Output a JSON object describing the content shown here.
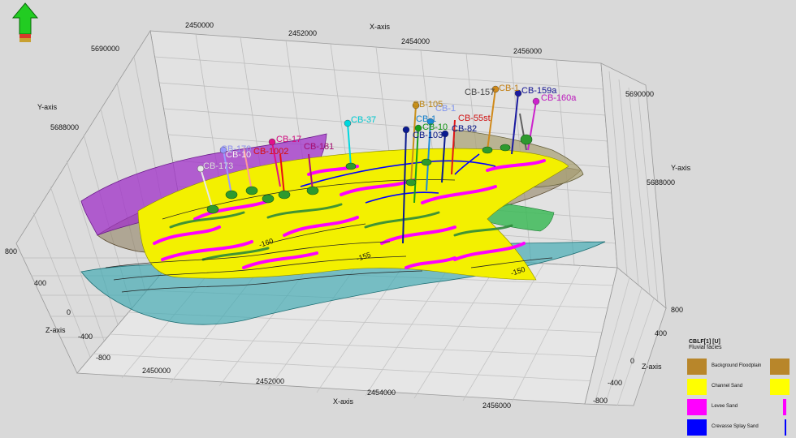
{
  "axes": {
    "x_title": "X-axis",
    "y_title": "Y-axis",
    "z_title": "Z-axis",
    "x_ticks_top": [
      "2450000",
      "2452000",
      "2454000",
      "2456000"
    ],
    "x_ticks_bottom": [
      "2450000",
      "2452000",
      "2454000",
      "2456000"
    ],
    "y_ticks_left": [
      "5690000",
      "5688000"
    ],
    "y_ticks_right": [
      "5690000",
      "5688000"
    ],
    "z_ticks_left": [
      "800",
      "400",
      "0",
      "-400",
      "-800"
    ],
    "z_ticks_right": [
      "800",
      "400",
      "0",
      "-400",
      "-800"
    ]
  },
  "wells": [
    {
      "name": "CB-157",
      "color": "#505050"
    },
    {
      "name": "CB-1",
      "color": "#d08a1a"
    },
    {
      "name": "CB-159a",
      "color": "#1a1aa0"
    },
    {
      "name": "CB-160a",
      "color": "#cc22cc"
    },
    {
      "name": "CB-105",
      "color": "#c8901a"
    },
    {
      "name": "CB-1",
      "color": "#8aa0ff"
    },
    {
      "name": "CB-37",
      "color": "#00d8e0"
    },
    {
      "name": "CB-55st",
      "color": "#e01818"
    },
    {
      "name": "CB-1",
      "color": "#1a8ad8"
    },
    {
      "name": "CB-10",
      "color": "#18a018"
    },
    {
      "name": "CB-82",
      "color": "#0a1a90"
    },
    {
      "name": "CB-103",
      "color": "#0a1a90"
    },
    {
      "name": "CB-17",
      "color": "#e0108a"
    },
    {
      "name": "CB-181",
      "color": "#b0107a"
    },
    {
      "name": "CB-170",
      "color": "#9a9aff"
    },
    {
      "name": "CB-1002",
      "color": "#e81010"
    },
    {
      "name": "CB-10",
      "color": "#ffffff"
    },
    {
      "name": "CB-173",
      "color": "#e8e8e8"
    }
  ],
  "contours": [
    "-150",
    "-155",
    "-160"
  ],
  "legend": {
    "title": "CBLF[1] [U]",
    "subtitle": "Fluvial facies",
    "items": [
      {
        "label": "Background Floodplain",
        "color": "#b8862a"
      },
      {
        "label": "Channel Sand",
        "color": "#ffff00"
      },
      {
        "label": "Levee Sand",
        "color": "#ff00ff"
      },
      {
        "label": "Crevasse Splay Sand",
        "color": "#0000ff"
      }
    ]
  },
  "north_arrow": {
    "icon": "north-arrow-icon",
    "color": "#22cc22"
  }
}
